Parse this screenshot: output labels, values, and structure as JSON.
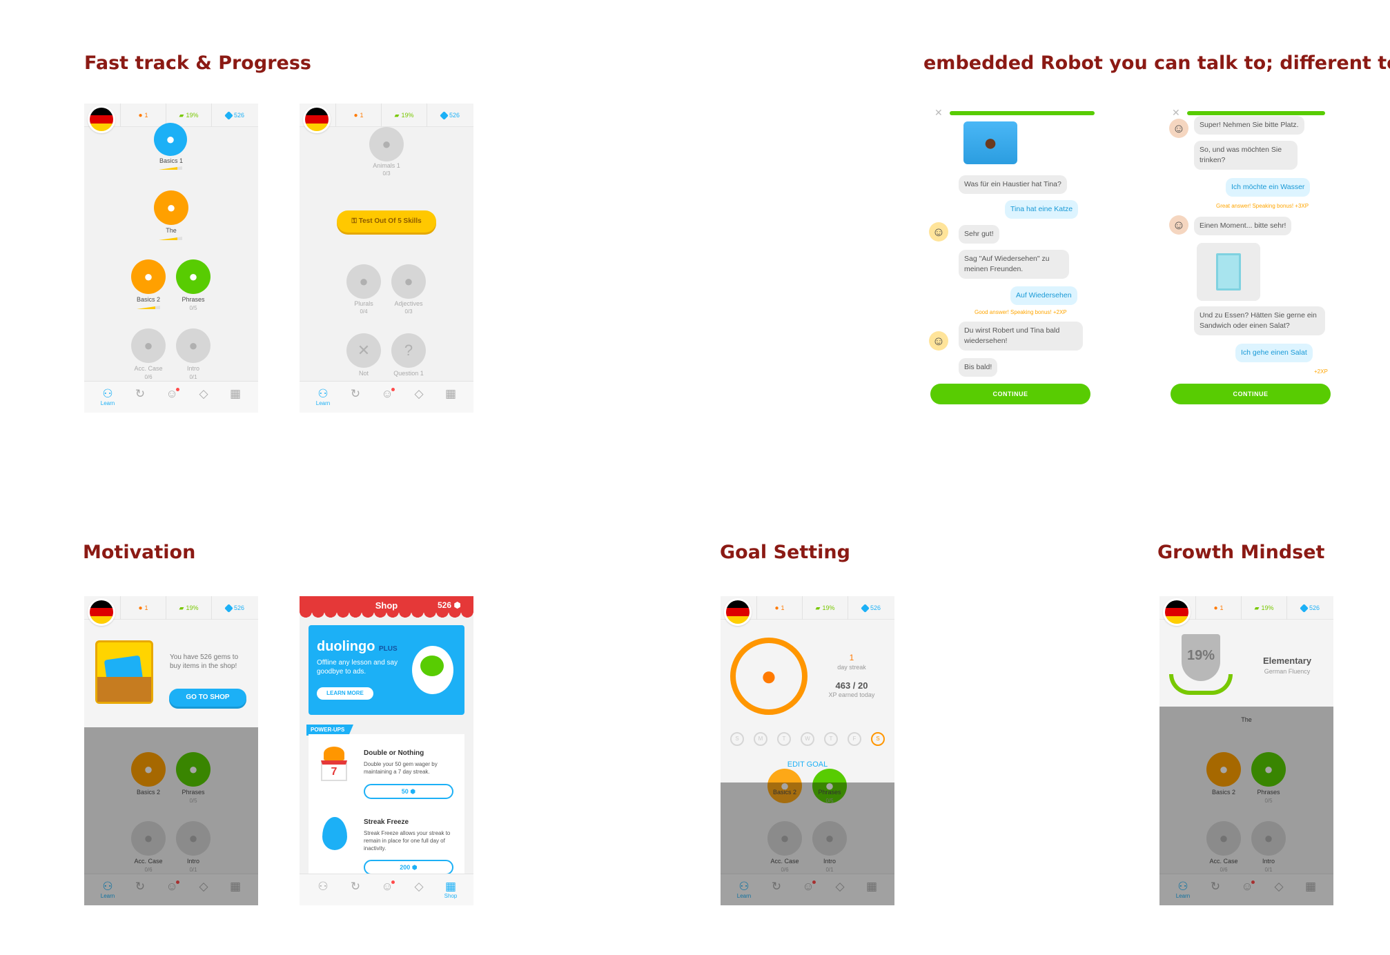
{
  "headings": {
    "fast_track": "Fast track & Progress",
    "robot": "embedded Robot you can talk to; different topics",
    "motivation": "Motivation",
    "goal": "Goal Setting",
    "growth": "Growth Mindset"
  },
  "topbar": {
    "streak": "1",
    "fluency": "19%",
    "gems": "526"
  },
  "nav": {
    "learn_label": "Learn",
    "shop_label": "Shop"
  },
  "colors": {
    "accent_green": "#58cc02",
    "accent_blue": "#1cb0f6",
    "accent_orange": "#ff9600",
    "heading": "#8b1a14",
    "shop_red": "#e53838"
  },
  "screen1": {
    "basics1": "Basics 1",
    "the": "The",
    "basics2": "Basics 2",
    "phrases": "Phrases",
    "phrases_sub": "0/5",
    "acc_case": "Acc. Case",
    "acc_case_sub": "0/6",
    "intro": "Intro",
    "intro_sub": "0/1"
  },
  "screen2": {
    "animals": "Animals 1",
    "animals_sub": "0/3",
    "test_out": "Test Out Of 5 Skills",
    "plurals": "Plurals",
    "plurals_sub": "0/4",
    "adjectives": "Adjectives",
    "adjectives_sub": "0/3",
    "not": "Not",
    "question": "Question 1"
  },
  "chat1": {
    "m1": "Was für ein Haustier hat Tina?",
    "m2": "Tina hat eine Katze",
    "m3": "Sehr gut!",
    "m4": "Sag \"Auf Wiedersehen\" zu meinen Freunden.",
    "m5": "Auf Wiedersehen",
    "bonus": "Good answer! Speaking bonus!  +2XP",
    "m6": "Du wirst Robert und Tina bald wiedersehen!",
    "m7": "Bis bald!",
    "continue": "CONTINUE"
  },
  "chat2": {
    "m1": "Super! Nehmen Sie bitte Platz.",
    "m2": "So, und was möchten Sie trinken?",
    "m3": "Ich möchte ein Wasser",
    "bonus1": "Great answer! Speaking bonus!  +3XP",
    "m4": "Einen Moment... bitte sehr!",
    "m5": "Und zu Essen? Hätten Sie gerne ein Sandwich oder einen Salat?",
    "m6": "Ich gehe einen Salat",
    "bonus2": "+2XP",
    "continue": "CONTINUE"
  },
  "motivation": {
    "gems_text": "You have 526 gems to buy items in the shop!",
    "go_shop": "GO TO SHOP",
    "basics2": "Basics 2",
    "phrases": "Phrases",
    "phrases_sub": "0/5",
    "acc_case": "Acc. Case",
    "acc_case_sub": "0/6",
    "intro": "Intro",
    "intro_sub": "0/1"
  },
  "shop": {
    "title": "Shop",
    "gems": "526",
    "plus_brand": "duolingo",
    "plus_tag": "PLUS",
    "plus_text": "Offline any lesson and say goodbye to ads.",
    "learn_more": "LEARN MORE",
    "powerups": "POWER-UPS",
    "item1_title": "Double or Nothing",
    "item1_desc": "Double your 50 gem wager by maintaining a 7 day streak.",
    "item1_calendar": "7",
    "item1_price": "50",
    "item2_title": "Streak Freeze",
    "item2_desc": "Streak Freeze allows your streak to remain in place for one full day of inactivity.",
    "item2_price": "200"
  },
  "goal": {
    "streak_num": "1",
    "streak_label": "day streak",
    "xp": "463 / 20",
    "xp_label": "XP earned today",
    "days": [
      "S",
      "M",
      "T",
      "W",
      "T",
      "F",
      "S"
    ],
    "edit": "EDIT GOAL",
    "basics2": "Basics 2",
    "phrases": "Phrases",
    "phrases_sub": "0/5",
    "acc_case": "Acc. Case",
    "acc_case_sub": "0/6",
    "intro": "Intro",
    "intro_sub": "0/1"
  },
  "growth": {
    "percent": "19%",
    "level": "Elementary",
    "sub": "German Fluency",
    "the": "The",
    "basics2": "Basics 2",
    "phrases": "Phrases",
    "phrases_sub": "0/5",
    "acc_case": "Acc. Case",
    "acc_case_sub": "0/6",
    "intro": "Intro",
    "intro_sub": "0/1"
  }
}
